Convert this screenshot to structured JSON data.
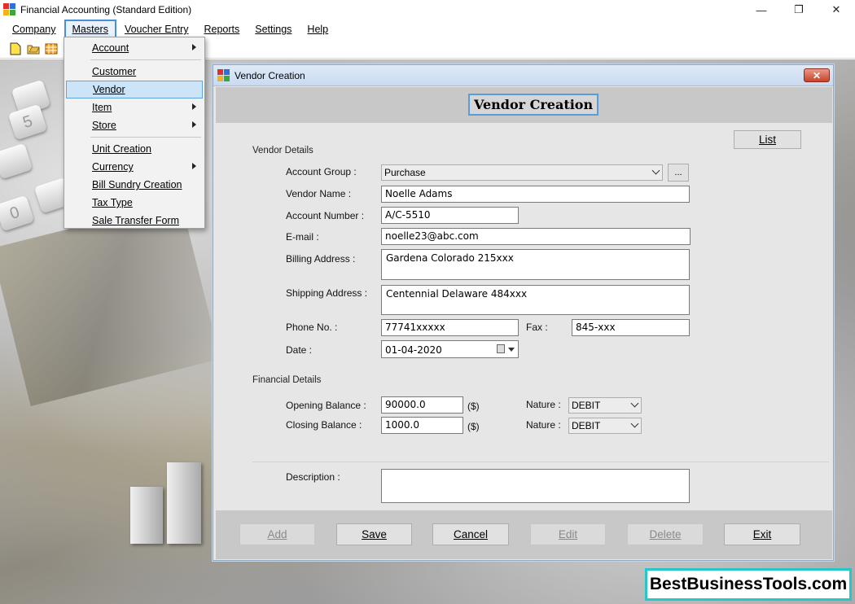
{
  "window": {
    "title": "Financial Accounting (Standard Edition)",
    "minimize": "—",
    "restore": "❐",
    "close": "✕"
  },
  "menubar": {
    "items": [
      {
        "label": "Company"
      },
      {
        "label": "Masters"
      },
      {
        "label": "Voucher Entry"
      },
      {
        "label": "Reports"
      },
      {
        "label": "Settings"
      },
      {
        "label": "Help"
      }
    ],
    "active": "Masters"
  },
  "toolbar": {
    "icons": [
      "new-document-icon",
      "open-folder-icon",
      "calendar-grid-icon"
    ]
  },
  "masters_menu": {
    "items": [
      {
        "label": "Account",
        "submenu": true
      },
      {
        "label": "Customer",
        "submenu": false
      },
      {
        "label": "Vendor",
        "submenu": false,
        "highlighted": true
      },
      {
        "label": "Item",
        "submenu": true
      },
      {
        "label": "Store",
        "submenu": true
      },
      {
        "label": "Unit Creation",
        "submenu": false
      },
      {
        "label": "Currency",
        "submenu": true
      },
      {
        "label": "Bill Sundry Creation",
        "submenu": false
      },
      {
        "label": "Tax Type",
        "submenu": false
      },
      {
        "label": "Sale Transfer Form",
        "submenu": false
      }
    ]
  },
  "vendor_window": {
    "title": "Vendor Creation",
    "heading": "Vendor Creation",
    "close": "✕",
    "list_button": "List",
    "vendor_details": {
      "section": "Vendor Details",
      "account_group": {
        "label": "Account Group :",
        "value": "Purchase",
        "browse": "..."
      },
      "vendor_name": {
        "label": "Vendor Name :",
        "value": "Noelle Adams"
      },
      "account_number": {
        "label": "Account Number :",
        "value": "A/C-5510"
      },
      "email": {
        "label": "E-mail :",
        "value": "noelle23@abc.com"
      },
      "billing_address": {
        "label": "Billing Address :",
        "value": "Gardena Colorado 215xxx"
      },
      "shipping_address": {
        "label": "Shipping Address :",
        "value": "Centennial Delaware 484xxx"
      },
      "phone": {
        "label": "Phone No. :",
        "value": "77741xxxxx"
      },
      "fax": {
        "label": "Fax :",
        "value": "845-xxx"
      },
      "date": {
        "label": "Date :",
        "value": "01-04-2020"
      }
    },
    "financial_details": {
      "section": "Financial Details",
      "opening_balance": {
        "label": "Opening Balance :",
        "value": "90000.0",
        "unit": "($)",
        "nature_label": "Nature :",
        "nature": "DEBIT"
      },
      "closing_balance": {
        "label": "Closing Balance :",
        "value": "1000.0",
        "unit": "($)",
        "nature_label": "Nature :",
        "nature": "DEBIT"
      }
    },
    "description": {
      "label": "Description :",
      "value": ""
    },
    "buttons": {
      "add": "Add",
      "save": "Save",
      "cancel": "Cancel",
      "edit": "Edit",
      "delete": "Delete",
      "exit": "Exit"
    }
  },
  "brand": "BestBusinessTools.com"
}
